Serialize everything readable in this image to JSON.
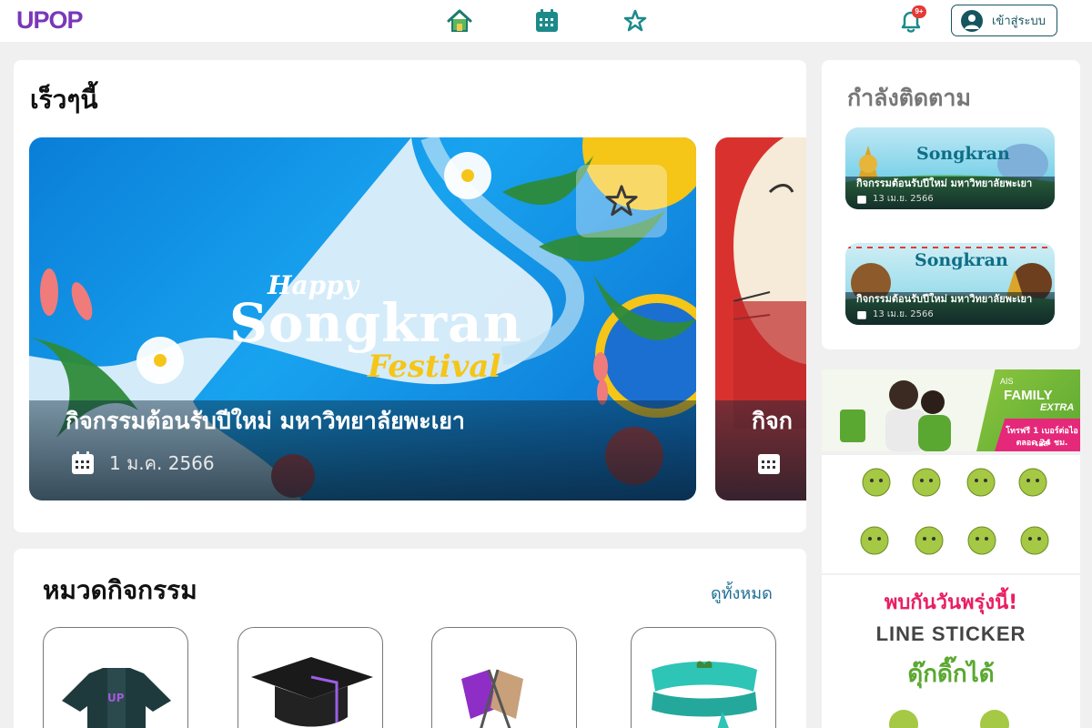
{
  "header": {
    "logo": "UPOP",
    "notification_badge": "9+",
    "login_label": "เข้าสู่ระบบ",
    "nav_icons": [
      "home-icon",
      "calendar-icon",
      "star-icon"
    ]
  },
  "recent": {
    "title": "เร็วๆนี้",
    "events": [
      {
        "title": "กิจกรรมต้อนรับปีใหม่ มหาวิทยาลัยพะเยา",
        "date": "1 ม.ค. 2566",
        "poster_text": {
          "line1": "Happy",
          "line2": "Songkran",
          "line3": "Festival"
        }
      },
      {
        "title": "กิจก"
      }
    ]
  },
  "categories": {
    "title": "หมวดกิจกรรม",
    "see_all": "ดูทั้งหมด",
    "tiles": [
      "shirt-icon",
      "graduation-cap-icon",
      "flags-icon",
      "headband-icon"
    ],
    "shirt_text": "UP"
  },
  "following": {
    "title": "กำลังติดตาม",
    "items": [
      {
        "title": "กิจกรรมต้อนรับปีใหม่ มหาวิทยาลัยพะเยา",
        "date": "13 เม.ย. 2566",
        "poster_text": "Songkran"
      },
      {
        "title": "กิจกรรมต้อนรับปีใหม่ มหาวิทยาลัยพะเยา",
        "date": "13 เม.ย. 2566",
        "poster_text": "Songkran"
      }
    ]
  },
  "ads": {
    "ais": {
      "brand": "AIS",
      "family": "FAMILY",
      "extra": "EXTRA",
      "note1": "โทรฟรี 1 เบอร์ต่อไอเอส",
      "note2": "ตลอด 24 ชม."
    },
    "line": {
      "top": "พบกันวันพรุ่งนี้!",
      "mid": "LINE STICKER",
      "bottom": "ดุ๊กดิ๊กได้"
    }
  },
  "colors": {
    "brand_purple": "#7a37b8",
    "accent_teal": "#15555f",
    "link_blue": "#1e6f96"
  }
}
